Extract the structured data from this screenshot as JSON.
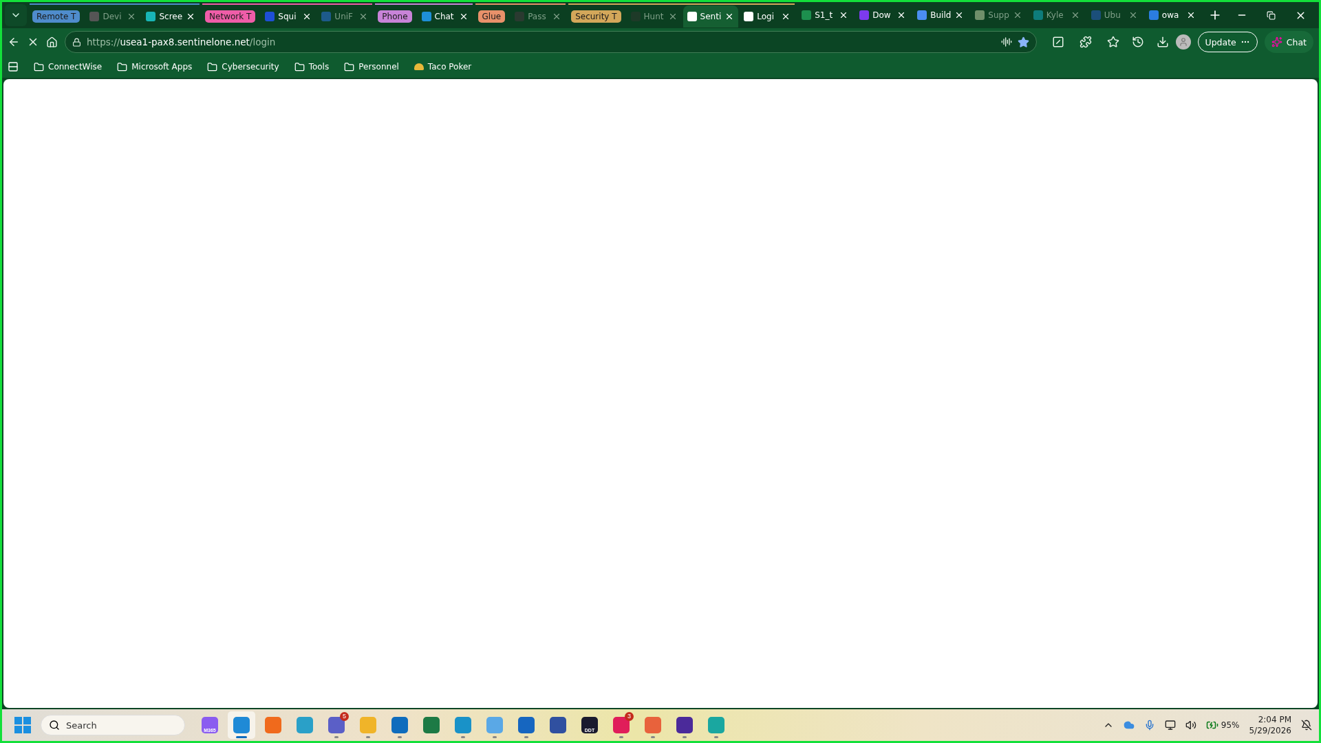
{
  "tab_strip": {
    "groups": [
      {
        "label": "Remote T",
        "color": "#4f8ccc",
        "tabs": [
          {
            "title": "Devi",
            "selected": false,
            "sleeping": true,
            "color": "#555555"
          },
          {
            "title": "Scree",
            "selected": false,
            "sleeping": false,
            "color": "#18b6b6"
          }
        ]
      },
      {
        "label": "Network T",
        "color": "#ef5da8",
        "tabs": [
          {
            "title": "Squi",
            "selected": false,
            "sleeping": false,
            "color": "#1e4fd6"
          },
          {
            "title": "UniF",
            "selected": false,
            "sleeping": true,
            "color": "#1d5a8a"
          }
        ]
      },
      {
        "label": "Phone",
        "color": "#c883d8",
        "tabs": [
          {
            "title": "Chat",
            "selected": false,
            "sleeping": false,
            "color": "#1e8fd8"
          }
        ]
      },
      {
        "label": "Glue",
        "color": "#e8916a",
        "tabs": [
          {
            "title": "Pass",
            "selected": false,
            "sleeping": true,
            "color": "#2a3a30"
          }
        ]
      },
      {
        "label": "Security T",
        "color": "#d3a75a",
        "tabs": [
          {
            "title": "Hunt",
            "selected": false,
            "sleeping": true,
            "color": "#1e3a28"
          },
          {
            "title": "Senti",
            "selected": true,
            "sleeping": false,
            "color": "#ffffff"
          },
          {
            "title": "Logi",
            "selected": false,
            "sleeping": false,
            "color": "#ffffff"
          }
        ]
      }
    ],
    "tabs": [
      {
        "title": "S1_t",
        "selected": false,
        "sleeping": false,
        "color": "#1d8f4e"
      },
      {
        "title": "Dow",
        "selected": false,
        "sleeping": false,
        "color": "#7c3aed"
      },
      {
        "title": "Build",
        "selected": false,
        "sleeping": false,
        "color": "#4b8ef0"
      },
      {
        "title": "Supp",
        "selected": false,
        "sleeping": true,
        "color": "#6f8f6a"
      },
      {
        "title": "Kyle",
        "selected": false,
        "sleeping": true,
        "color": "#0e7c7b"
      },
      {
        "title": "Ubu",
        "selected": false,
        "sleeping": true,
        "color": "#1b4f7a"
      },
      {
        "title": "owa",
        "selected": false,
        "sleeping": false,
        "color": "#2b7de0"
      }
    ]
  },
  "address_bar": {
    "scheme": "https://",
    "host": "usea1-pax8.sentinelone.net",
    "path": "/login"
  },
  "toolbar": {
    "update_button": "Update",
    "chat_button": "Chat"
  },
  "bookmarks": [
    {
      "label": "ConnectWise",
      "kind": "folder"
    },
    {
      "label": "Microsoft Apps",
      "kind": "folder"
    },
    {
      "label": "Cybersecurity",
      "kind": "folder"
    },
    {
      "label": "Tools",
      "kind": "folder"
    },
    {
      "label": "Personnel",
      "kind": "folder"
    },
    {
      "label": "Taco Poker",
      "kind": "link"
    }
  ],
  "taskbar": {
    "search": {
      "placeholder": "Search"
    },
    "apps": [
      {
        "color": "#8a5cf0",
        "selected": false,
        "running": false,
        "caption": "M365"
      },
      {
        "color": "#1f8ad6",
        "selected": true,
        "running": true
      },
      {
        "color": "#f06a1c",
        "selected": false,
        "running": false
      },
      {
        "color": "#2aa0c8",
        "selected": false,
        "running": false
      },
      {
        "color": "#5b5fc7",
        "selected": false,
        "running": true,
        "badge": "5"
      },
      {
        "color": "#f0b429",
        "selected": false,
        "running": true
      },
      {
        "color": "#0f6cbd",
        "selected": false,
        "running": true
      },
      {
        "color": "#1d7a45",
        "selected": false,
        "running": false
      },
      {
        "color": "#1992c8",
        "selected": false,
        "running": true
      },
      {
        "color": "#5aa8e6",
        "selected": false,
        "running": true
      },
      {
        "color": "#1666c0",
        "selected": false,
        "running": true
      },
      {
        "color": "#3050a0",
        "selected": false,
        "running": false
      },
      {
        "color": "#1a1a2e",
        "selected": false,
        "running": false,
        "caption": "DDT"
      },
      {
        "color": "#e01e5a",
        "selected": false,
        "running": true,
        "badge": "3"
      },
      {
        "color": "#e8623c",
        "selected": false,
        "running": true
      },
      {
        "color": "#4b2a9a",
        "selected": false,
        "running": true
      },
      {
        "color": "#1aa7a0",
        "selected": false,
        "running": true
      }
    ],
    "tray": {
      "battery": "95%",
      "time": "2:04 PM",
      "date": "5/29/2026"
    }
  }
}
